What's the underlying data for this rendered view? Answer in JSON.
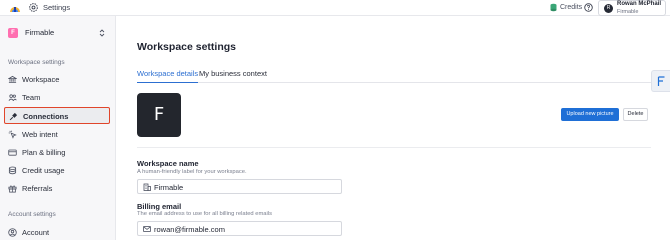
{
  "topbar": {
    "title": "Settings",
    "credits_label": "Credits",
    "account": {
      "name": "Rowan McPhail",
      "org": "Firmable",
      "initial": "R"
    }
  },
  "sidebar": {
    "org": {
      "initial": "F",
      "name": "Firmable"
    },
    "workspace_section_label": "Workspace settings",
    "items": [
      {
        "label": "Workspace",
        "icon": "bank-icon",
        "active": false
      },
      {
        "label": "Team",
        "icon": "team-icon",
        "active": false
      },
      {
        "label": "Connections",
        "icon": "plug-icon",
        "active": true
      },
      {
        "label": "Web intent",
        "icon": "cursor-click-icon",
        "active": false
      },
      {
        "label": "Plan & billing",
        "icon": "credit-card-icon",
        "active": false
      },
      {
        "label": "Credit usage",
        "icon": "coins-icon",
        "active": false
      },
      {
        "label": "Referrals",
        "icon": "gift-icon",
        "active": false
      }
    ],
    "account_section_label": "Account settings",
    "account_items": [
      {
        "label": "Account",
        "icon": "user-circle-icon"
      }
    ]
  },
  "main": {
    "title": "Workspace settings",
    "tabs": [
      {
        "label": "Workspace details",
        "active": true
      },
      {
        "label": "My business context",
        "active": false
      }
    ],
    "picture": {
      "initial": "F",
      "upload_label": "Upload new picture",
      "delete_label": "Delete"
    },
    "fields": [
      {
        "label": "Workspace name",
        "help": "A human-friendly label for your workspace.",
        "value": "Firmable",
        "icon": "building-icon"
      },
      {
        "label": "Billing email",
        "help": "The email address to use for all billing related emails",
        "value": "rowan@firmable.com",
        "icon": "mail-icon"
      }
    ]
  },
  "colors": {
    "accent": "#1f6fd6",
    "active_tab": "#2c6fd1",
    "highlight_border": "#e0452b",
    "org_badge": "#ff6fb0"
  }
}
